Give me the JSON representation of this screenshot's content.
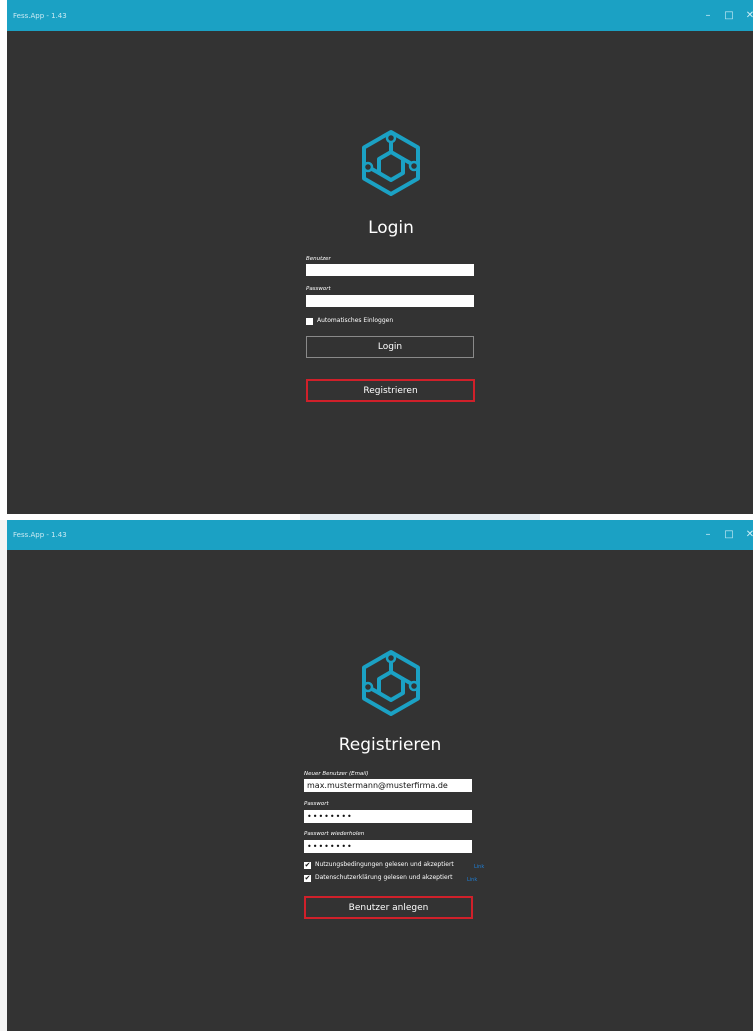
{
  "app": {
    "title": "Fess.App - 1.43"
  },
  "login_window": {
    "heading": "Login",
    "user_label": "Benutzer",
    "user_value": "",
    "password_label": "Passwort",
    "password_value": "",
    "auto_login_label": "Automatisches Einloggen",
    "auto_login_checked": false,
    "login_button": "Login",
    "register_button": "Registrieren"
  },
  "register_window": {
    "heading": "Registrieren",
    "email_label": "Neuer Benutzer (Email)",
    "email_value": "max.mustermann@musterfirma.de",
    "password_label": "Passwort",
    "password_value": "••••••••",
    "password_repeat_label": "Passwort wiederholen",
    "password_repeat_value": "••••••••",
    "terms_label": "Nutzungsbedingungen gelesen und akzeptiert",
    "terms_link": "Link",
    "privacy_label": "Datenschutzerklärung gelesen und akzeptiert",
    "privacy_link": "Link",
    "create_button": "Benutzer anlegen"
  },
  "icons": {
    "minimize": "–",
    "maximize": "□",
    "close": "✕",
    "check": "✔"
  },
  "colors": {
    "titlebar": "#1ba1c4",
    "window_bg": "#333333",
    "logo": "#1ba1c4",
    "highlight": "#d0202a",
    "link": "#1e7fd6"
  }
}
